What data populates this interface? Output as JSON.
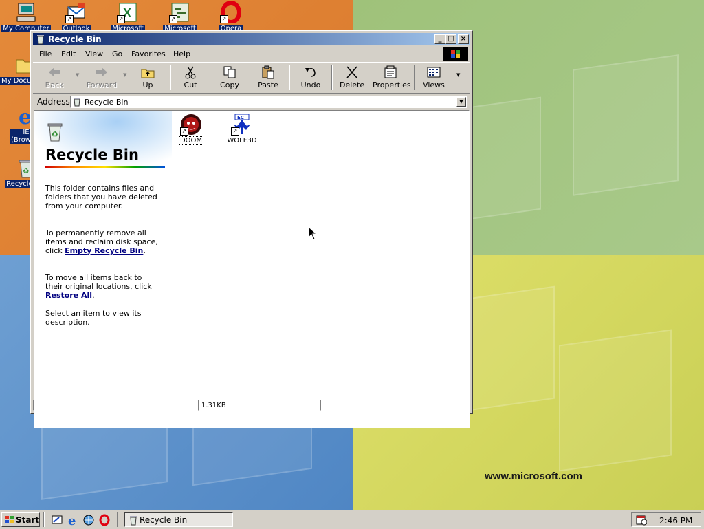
{
  "desktop": {
    "icons": [
      {
        "label": "My Computer"
      },
      {
        "label": "Outlook"
      },
      {
        "label": "Microsoft"
      },
      {
        "label": "Microsoft"
      },
      {
        "label": "Opera"
      },
      {
        "label": "My Documents"
      },
      {
        "label": "IE (Browser)"
      },
      {
        "label": "Recycle Bin"
      }
    ],
    "wallpaper_url": "www.microsoft.com"
  },
  "window": {
    "title": "Recycle Bin",
    "controls": {
      "minimize": "_",
      "maximize": "□",
      "close": "×"
    },
    "menu": [
      {
        "label": "File",
        "hotkey": "F"
      },
      {
        "label": "Edit",
        "hotkey": "E"
      },
      {
        "label": "View",
        "hotkey": "V"
      },
      {
        "label": "Go",
        "hotkey": "G"
      },
      {
        "label": "Favorites",
        "hotkey": "a"
      },
      {
        "label": "Help",
        "hotkey": "H"
      }
    ],
    "toolbar": {
      "back": "Back",
      "forward": "Forward",
      "up": "Up",
      "cut": "Cut",
      "copy": "Copy",
      "paste": "Paste",
      "undo": "Undo",
      "delete": "Delete",
      "properties": "Properties",
      "views": "Views"
    },
    "address": {
      "label": "Address",
      "value": "Recycle Bin"
    },
    "webview": {
      "title": "Recycle Bin",
      "p1": "This folder contains files and folders that you have deleted from your computer.",
      "p2_pre": "To permanently remove all items and reclaim disk space, click ",
      "p2_link": "Empty Recycle Bin",
      "p3_pre": "To move all items back to their original locations, click ",
      "p3_link": "Restore All",
      "p4": "Select an item to view its description."
    },
    "files": [
      {
        "label": "DOOM"
      },
      {
        "label": "WOLF3D"
      }
    ],
    "status": {
      "size": "1.31KB"
    }
  },
  "taskbar": {
    "start_label": "Start",
    "task_label": "Recycle Bin",
    "clock": "2:46 PM"
  },
  "colors": {
    "title_active": "#0a246a",
    "selection": "#0a246a",
    "face": "#d4d0c8",
    "link": "#000080"
  }
}
